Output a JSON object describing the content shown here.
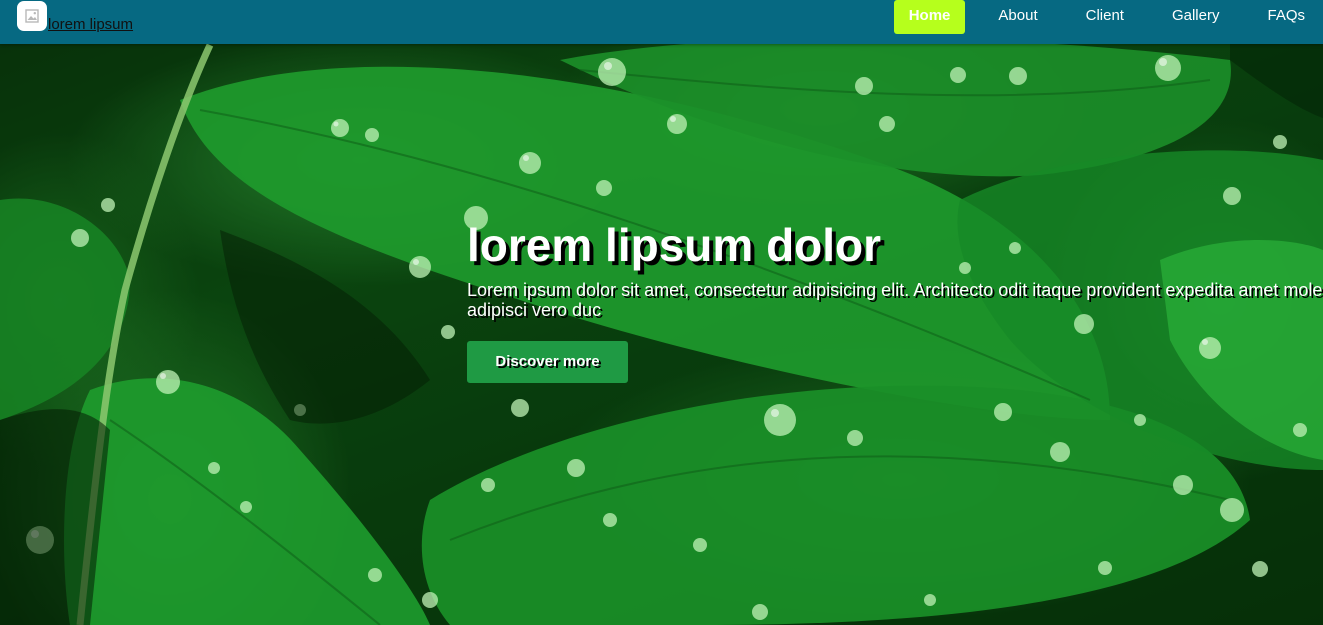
{
  "brand": {
    "name": " lorem lipsum",
    "logo_icon": "image-placeholder-icon"
  },
  "nav": {
    "items": [
      {
        "label": "Home",
        "active": true
      },
      {
        "label": "About",
        "active": false
      },
      {
        "label": "Client",
        "active": false
      },
      {
        "label": "Gallery",
        "active": false
      },
      {
        "label": "FAQs",
        "active": false
      }
    ]
  },
  "hero": {
    "title": "lorem lipsum dolor",
    "text": "Lorem ipsum dolor sit amet, consectetur adipisicing elit. Architecto odit itaque provident expedita amet molestias adipisci vero duc",
    "cta_label": "Discover more",
    "background": "green leaves with water droplets"
  },
  "colors": {
    "navbar": "#066982",
    "active_nav": "#b6ff1c",
    "cta": "#1f9a44",
    "text": "#ffffff"
  }
}
